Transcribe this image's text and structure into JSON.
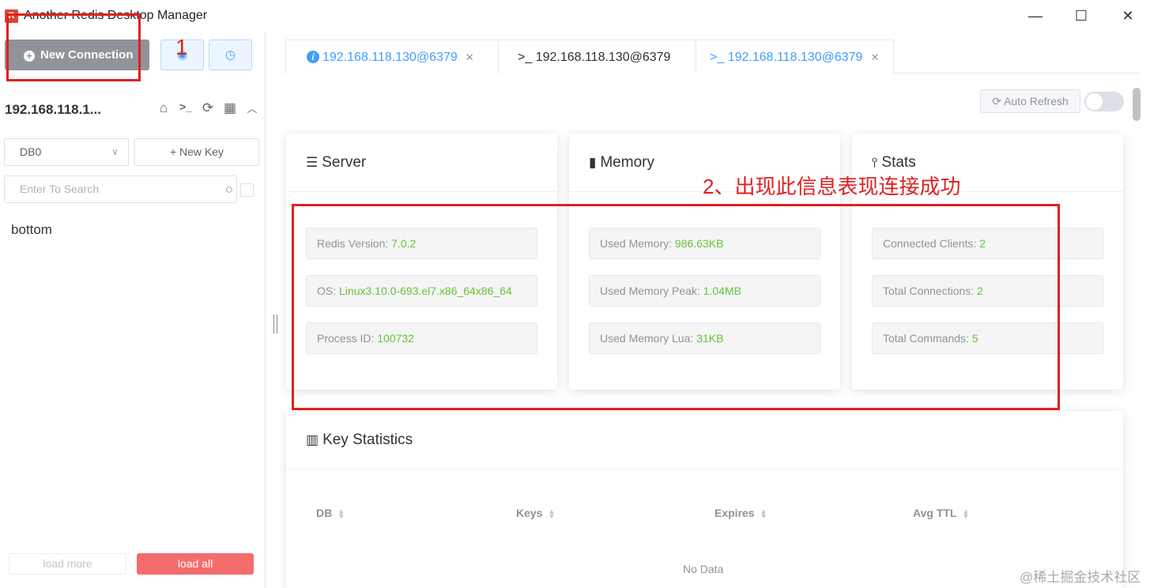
{
  "window": {
    "title": "Another Redis Desktop Manager",
    "logo_text": "R",
    "minimize": "—",
    "maximize": "☐",
    "close": "✕"
  },
  "sidebar": {
    "new_connection_label": "New Connection",
    "connection_name": "192.168.118.1...",
    "db_select_value": "DB0",
    "new_key_label": "+ New Key",
    "search_placeholder": "Enter To Search",
    "keys": [
      "bottom"
    ],
    "load_more_label": "load more",
    "load_all_label": "load all"
  },
  "tabs": [
    {
      "label": "192.168.118.130@6379",
      "icon": "info-icon",
      "closable": true,
      "active": true
    },
    {
      "label": ">_ 192.168.118.130@6379",
      "icon": "terminal-icon",
      "closable": false,
      "active": false
    },
    {
      "label": ">_ 192.168.118.130@6379",
      "icon": "terminal-icon",
      "closable": true,
      "active": false
    }
  ],
  "toolbar": {
    "auto_refresh_label": "Auto Refresh",
    "auto_refresh_on": false
  },
  "server": {
    "title": "Server",
    "redis_version_label": "Redis Version:",
    "redis_version": "7.0.2",
    "os_label": "OS:",
    "os": "Linux3.10.0-693.el7.x86_64x86_64",
    "process_id_label": "Process ID:",
    "process_id": "100732"
  },
  "memory": {
    "title": "Memory",
    "used_memory_label": "Used Memory:",
    "used_memory": "986.63KB",
    "used_memory_peak_label": "Used Memory Peak:",
    "used_memory_peak": "1.04MB",
    "used_memory_lua_label": "Used Memory Lua:",
    "used_memory_lua": "31KB"
  },
  "stats": {
    "title": "Stats",
    "connected_clients_label": "Connected Clients:",
    "connected_clients": "2",
    "total_connections_label": "Total Connections:",
    "total_connections": "2",
    "total_commands_label": "Total Commands:",
    "total_commands": "5"
  },
  "key_statistics": {
    "title": "Key Statistics",
    "columns": [
      "DB",
      "Keys",
      "Expires",
      "Avg TTL"
    ],
    "empty_text": "No Data"
  },
  "annotations": {
    "step1": "1",
    "step2": "2、出现此信息表现连接成功"
  },
  "watermark": "@稀土掘金技术社区",
  "colors": {
    "accent": "#409eff",
    "value_green": "#67c23a",
    "annotation_red": "#e02020",
    "load_all_bg": "#f56c6c"
  }
}
